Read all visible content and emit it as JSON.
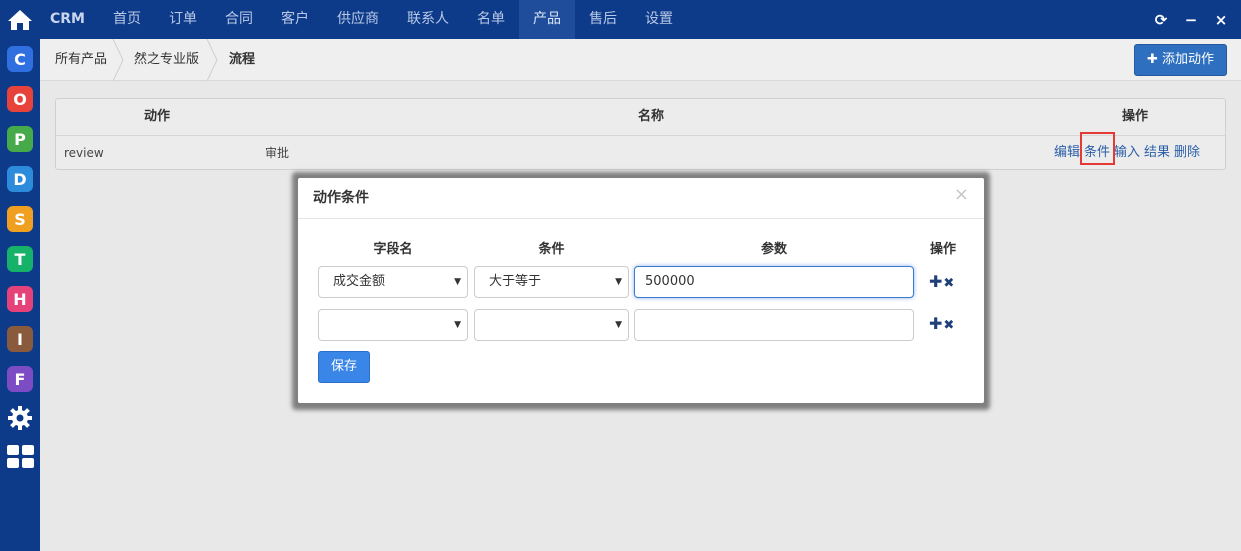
{
  "brand": "CRM",
  "nav": [
    "首页",
    "订单",
    "合同",
    "客户",
    "供应商",
    "联系人",
    "名单",
    "产品",
    "售后",
    "设置"
  ],
  "nav_active_index": 7,
  "window_controls": {
    "refresh": "⟳",
    "minimize": "−",
    "close": "×"
  },
  "dock_apps": [
    {
      "letter": "C",
      "color": "#2f6fe0",
      "name": "crm"
    },
    {
      "letter": "O",
      "color": "#e8433a",
      "name": "oa"
    },
    {
      "letter": "P",
      "color": "#46a94a",
      "name": "project"
    },
    {
      "letter": "D",
      "color": "#2c8bdb",
      "name": "doc"
    },
    {
      "letter": "S",
      "color": "#f0a020",
      "name": "cash"
    },
    {
      "letter": "T",
      "color": "#17b26a",
      "name": "team"
    },
    {
      "letter": "H",
      "color": "#e6427a",
      "name": "hr"
    },
    {
      "letter": "I",
      "color": "#8a5a3c",
      "name": "info"
    },
    {
      "letter": "F",
      "color": "#7b4cc4",
      "name": "finance"
    }
  ],
  "breadcrumb": {
    "root": "所有产品",
    "product": "然之专业版",
    "current": "流程"
  },
  "add_action_label": "添加动作",
  "table": {
    "headers": {
      "action": "动作",
      "name": "名称",
      "ops": "操作"
    },
    "row": {
      "action": "review",
      "name": "审批"
    },
    "row_actions": [
      "编辑",
      "条件",
      "输入",
      "结果",
      "删除"
    ]
  },
  "modal": {
    "title": "动作条件",
    "close": "×",
    "headers": {
      "field": "字段名",
      "condition": "条件",
      "param": "参数",
      "ops": "操作"
    },
    "rows": [
      {
        "field": "成交金额",
        "condition": "大于等于",
        "param": "500000"
      },
      {
        "field": "",
        "condition": "",
        "param": ""
      }
    ],
    "add_glyph": "✚",
    "remove_glyph": "✖",
    "save_label": "保存"
  }
}
